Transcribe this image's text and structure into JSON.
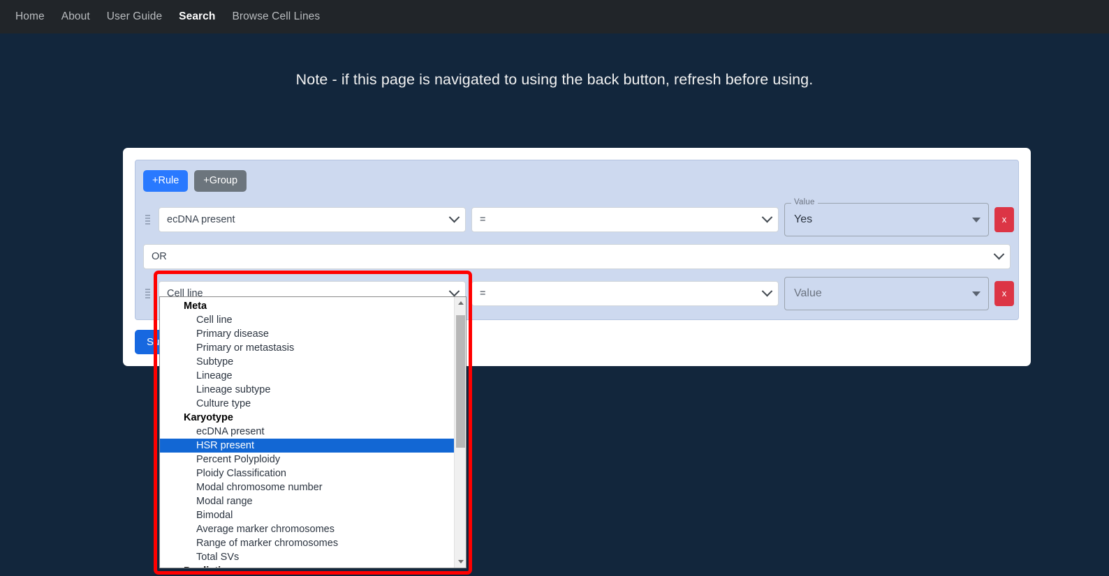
{
  "navbar": {
    "items": [
      {
        "label": "Home",
        "active": false
      },
      {
        "label": "About",
        "active": false
      },
      {
        "label": "User Guide",
        "active": false
      },
      {
        "label": "Search",
        "active": true
      },
      {
        "label": "Browse Cell Lines",
        "active": false
      }
    ]
  },
  "note": "Note - if this page is navigated to using the back button, refresh before using.",
  "query_builder": {
    "add_rule_label": "+Rule",
    "add_group_label": "+Group",
    "submit_label": "Submit",
    "delete_label": "x",
    "connector": {
      "value": "OR"
    },
    "rules": [
      {
        "field": "ecDNA present",
        "operator": "=",
        "value_legend": "Value",
        "value": "Yes",
        "value_is_placeholder": false
      },
      {
        "field": "Cell line",
        "operator": "=",
        "value_legend": "Value",
        "value": "Value",
        "value_is_placeholder": true
      }
    ]
  },
  "field_dropdown": {
    "selected": "HSR present",
    "options": [
      {
        "label": "Meta",
        "group": true
      },
      {
        "label": "Cell line",
        "group": false
      },
      {
        "label": "Primary disease",
        "group": false
      },
      {
        "label": "Primary or metastasis",
        "group": false
      },
      {
        "label": "Subtype",
        "group": false
      },
      {
        "label": "Lineage",
        "group": false
      },
      {
        "label": "Lineage subtype",
        "group": false
      },
      {
        "label": "Culture type",
        "group": false
      },
      {
        "label": "Karyotype",
        "group": true
      },
      {
        "label": "ecDNA present",
        "group": false
      },
      {
        "label": "HSR present",
        "group": false
      },
      {
        "label": "Percent Polyploidy",
        "group": false
      },
      {
        "label": "Ploidy Classification",
        "group": false
      },
      {
        "label": "Modal chromosome number",
        "group": false
      },
      {
        "label": "Modal range",
        "group": false
      },
      {
        "label": "Bimodal",
        "group": false
      },
      {
        "label": "Average marker chromosomes",
        "group": false
      },
      {
        "label": "Range of marker chromosomes",
        "group": false
      },
      {
        "label": "Total SVs",
        "group": false
      },
      {
        "label": "Predictions",
        "group": true
      }
    ]
  },
  "colors": {
    "page_background": "#12263c",
    "navbar_background": "#212529",
    "panel_background": "#cdd9ef",
    "add_rule": "#2979ff",
    "add_group": "#6c757d",
    "delete": "#dc3545",
    "submit": "#1768e0",
    "highlight": "#1267d4",
    "annotation": "#ff0000"
  }
}
